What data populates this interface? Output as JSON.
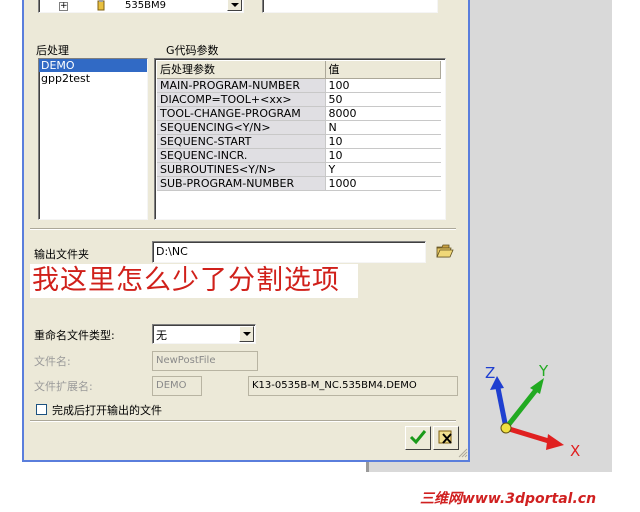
{
  "top_tree": {
    "item_label": "535BM9"
  },
  "postprocess": {
    "group_label": "后处理",
    "items": [
      "DEMO",
      "gpp2test"
    ],
    "selected_index": 0
  },
  "gcode": {
    "group_label": "G代码参数",
    "columns": [
      "后处理参数",
      "值"
    ],
    "rows": [
      {
        "param": "MAIN-PROGRAM-NUMBER",
        "value": "100"
      },
      {
        "param": "DIACOMP=TOOL+<xx>",
        "value": "50"
      },
      {
        "param": "TOOL-CHANGE-PROGRAM",
        "value": "8000"
      },
      {
        "param": "SEQUENCING<Y/N>",
        "value": "N"
      },
      {
        "param": "SEQUENC-START",
        "value": "10"
      },
      {
        "param": "SEQUENC-INCR.",
        "value": "10"
      },
      {
        "param": "SUBROUTINES<Y/N>",
        "value": "Y"
      },
      {
        "param": "SUB-PROGRAM-NUMBER",
        "value": "1000"
      }
    ]
  },
  "output": {
    "folder_label": "输出文件夹",
    "folder_value": "D:\\NC",
    "rename_label": "重命名文件类型:",
    "rename_value": "无",
    "filename_label": "文件名:",
    "filename_placeholder": "NewPostFile",
    "ext_label": "文件扩展名:",
    "ext_placeholder": "DEMO",
    "full_path": "K13-0535B-M_NC.535BM4.DEMO",
    "open_after_label": "完成后打开输出的文件",
    "open_after_checked": false
  },
  "annotation": "我这里怎么少了分割选项",
  "axes": {
    "x": "X",
    "y": "Y",
    "z": "Z",
    "x_color": "#e02020",
    "y_color": "#22aa22",
    "z_color": "#1f3fd0"
  },
  "watermark": "三维网www.3dportal.cn",
  "icons": {
    "ok": "check-icon",
    "cancel": "cancel-icon",
    "browse": "folder-open-icon"
  }
}
